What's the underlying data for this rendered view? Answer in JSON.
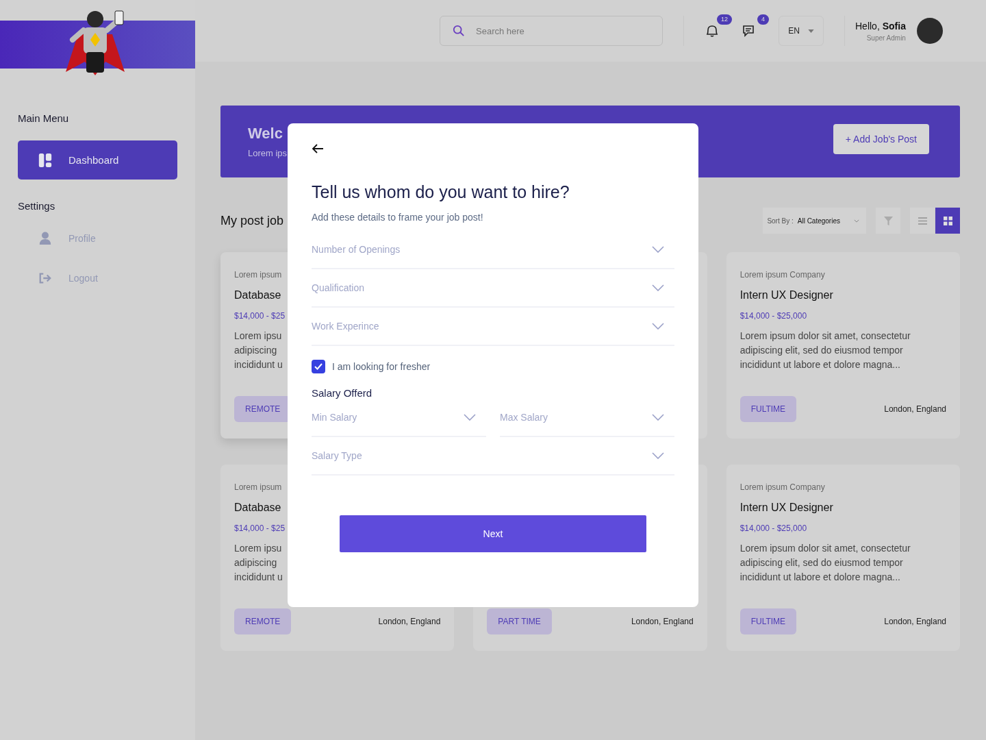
{
  "sidebar": {
    "sections": [
      {
        "title": "Main Menu",
        "items": [
          {
            "label": "Dashboard",
            "kind": "dashboard",
            "selected": true
          }
        ]
      },
      {
        "title": "Settings",
        "items": [
          {
            "label": "Profile",
            "kind": "profile",
            "selected": false
          },
          {
            "label": "Logout",
            "kind": "logout",
            "selected": false
          }
        ]
      }
    ]
  },
  "header": {
    "search": {
      "placeholder": "Search here"
    },
    "notifications": "12",
    "messages": "4",
    "language": "EN",
    "greeting": "Hello, **Sofia**",
    "role": "Super Admin"
  },
  "banner": {
    "title": "Welc",
    "subtitle": "Lorem ips",
    "button": "+ Add Job's Post"
  },
  "jobs": {
    "title": "My post job",
    "sort_label": "Sort By :",
    "sort_value": "All Categories",
    "views": [
      {
        "kind": "list",
        "selected": false
      },
      {
        "kind": "grid",
        "selected": true
      }
    ]
  },
  "cards": [
    {
      "company": "Lorem ipsum",
      "title": "Database",
      "salary": "$14,000 - $25",
      "lines": [
        "Lorem ipsu",
        "adipiscing",
        "incididunt u"
      ],
      "tag": "REMOTE"
    },
    {
      "company": "Lorem ipsum Company",
      "title": "Intern UX Designer",
      "salary": "$14,000 - $25,000",
      "lines": [
        "Lorem ipsum dolor sit amet, consectetur",
        "adipiscing elit, sed do eiusmod tempor",
        "incididunt ut labore et dolore magna..."
      ],
      "tag": "FULTIME",
      "location": "London, England"
    },
    {
      "company": "Lorem ipsum",
      "title": "Database",
      "salary": "$14,000 - $25",
      "lines": [
        "Lorem ipsu",
        "adipiscing",
        "incididunt u"
      ],
      "tag": "REMOTE",
      "location": "London, England"
    },
    {
      "tag": "PART TIME",
      "location": "London, England"
    },
    {
      "company": "Lorem ipsum Company",
      "title": "Intern UX Designer",
      "salary": "$14,000 - $25,000",
      "lines": [
        "Lorem ipsum dolor sit amet, consectetur",
        "adipiscing elit, sed do eiusmod tempor",
        "incididunt ut labore et dolore magna..."
      ],
      "tag": "FULTIME",
      "location": "London, England"
    }
  ],
  "dialog": {
    "title": "Tell us whom do you want to hire?",
    "subtitle": "Add these details to frame your job post!",
    "fields": [
      {
        "placeholder": "Number of Openings"
      },
      {
        "placeholder": "Qualification"
      },
      {
        "placeholder": "Work Experince"
      }
    ],
    "fresher": {
      "label": "I am looking for fresher",
      "checked": true
    },
    "salary_title": "Salary Offerd",
    "salary_fields": [
      {
        "placeholder": "Min Salary"
      },
      {
        "placeholder": "Max Salary"
      }
    ],
    "salary_type": {
      "placeholder": "Salary Type"
    },
    "next": "Next"
  }
}
